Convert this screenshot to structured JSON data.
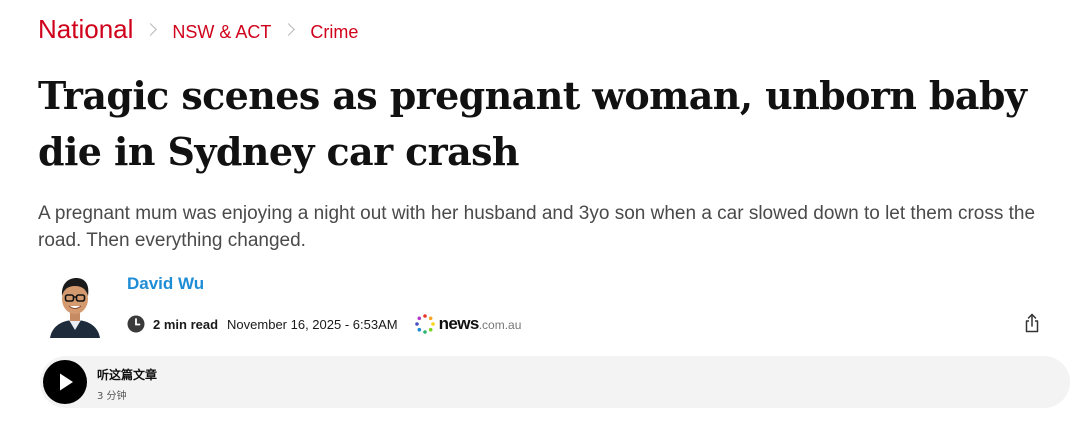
{
  "breadcrumb": {
    "section": "National",
    "subsection": "NSW & ACT",
    "category": "Crime"
  },
  "article": {
    "headline": "Tragic scenes as pregnant woman, unborn baby die in Sydney car crash",
    "standfirst": "A pregnant mum was enjoying a night out with her husband and 3yo son when a car slowed down to let them cross the road. Then everything changed."
  },
  "author": {
    "name": "David Wu"
  },
  "meta": {
    "read_time": "2 min read",
    "date": "November 16, 2025 - 6:53AM",
    "source_bold": "news",
    "source_light": ".com.au"
  },
  "audio": {
    "title": "听这篇文章",
    "duration": "3 分钟"
  },
  "colors": {
    "accent_red": "#d0021b",
    "author_blue": "#1f8dd6"
  },
  "icons": {
    "clock": "clock-icon",
    "share": "share-icon",
    "play": "play-icon",
    "brand": "news-dots-logo-icon"
  }
}
